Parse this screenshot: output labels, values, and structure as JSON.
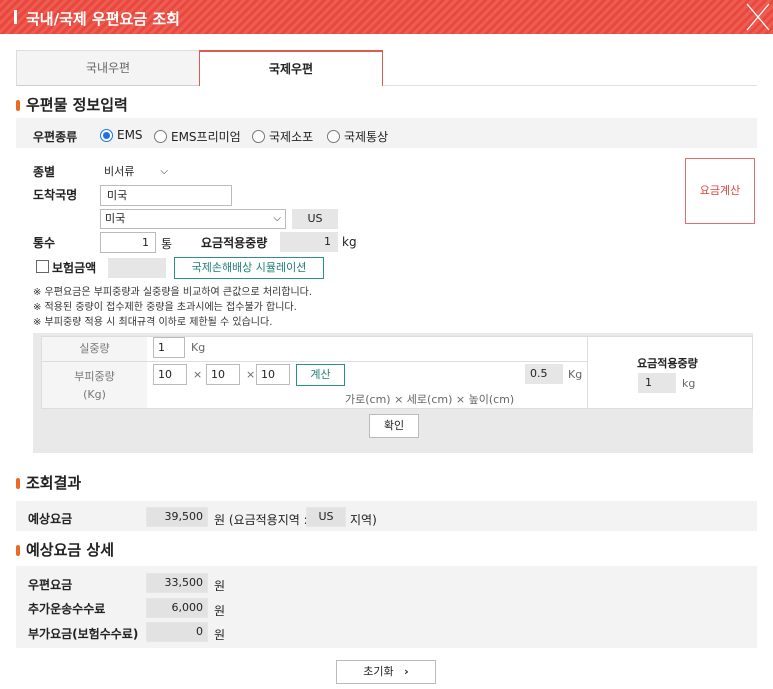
{
  "header": {
    "title": "국내/국제 우편요금 조회"
  },
  "tabs": [
    {
      "label": "국내우편"
    },
    {
      "label": "국제우편"
    }
  ],
  "sections": {
    "input": "우편물 정보입력",
    "result": "조회결과",
    "detail": "예상요금 상세"
  },
  "post_type": {
    "label": "우편종류",
    "options": [
      {
        "label": "EMS",
        "checked": true
      },
      {
        "label": "EMS프리미엄",
        "checked": false
      },
      {
        "label": "국제소포",
        "checked": false
      },
      {
        "label": "국제통상",
        "checked": false
      }
    ]
  },
  "form": {
    "kind_label": "종별",
    "kind_value": "비서류",
    "dest_label": "도착국명",
    "dest_input": "미국",
    "dest_select": "미국",
    "country_code": "US",
    "count_label": "통수",
    "count_value": "1",
    "count_unit": "통",
    "applied_weight_label": "요금적용중량",
    "applied_weight_value": "1",
    "applied_weight_unit": "kg",
    "insurance_label": "보험금액",
    "insurance_sim_button": "국제손해배상 시뮬레이션",
    "calc_button": "요금계산"
  },
  "notes": [
    "※ 우편요금은 부피중량과 실중량을 비교하여 큰값으로 처리합니다.",
    "※ 적용된 중량이 접수제한 중량을 초과시에는 접수불가 합니다.",
    "※ 부피중량 적용 시 최대규격 이하로 제한될 수 있습니다."
  ],
  "calc": {
    "actual_weight_label": "실중량",
    "actual_weight_value": "1",
    "actual_weight_unit": "Kg",
    "volume_label_1": "부피중량",
    "volume_label_2": "(Kg)",
    "width": "10",
    "length": "10",
    "height": "10",
    "times": "×",
    "calc_button": "계산",
    "volume_result": "0.5",
    "volume_unit": "Kg",
    "dims_caption": "가로(cm) × 세로(cm) × 높이(cm)",
    "applied_label": "요금적용중량",
    "applied_value": "1",
    "applied_unit": "kg",
    "confirm_button": "확인"
  },
  "result": {
    "label": "예상요금",
    "value": "39,500",
    "unit_prefix": "원 (요금적용지역 :",
    "region": "US",
    "unit_suffix": "지역)"
  },
  "detail": [
    {
      "label": "우편요금",
      "value": "33,500",
      "unit": "원"
    },
    {
      "label": "추가운송수수료",
      "value": "6,000",
      "unit": "원"
    },
    {
      "label": "부가요금(보험수수료)",
      "value": "0",
      "unit": "원"
    }
  ],
  "reset_button": {
    "label": "초기화",
    "arrow": "›"
  }
}
